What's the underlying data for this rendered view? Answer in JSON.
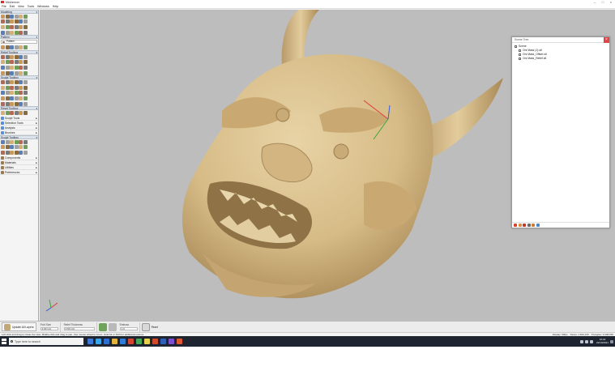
{
  "window": {
    "title": "Meshmixer",
    "controls": [
      "–",
      "□",
      "×"
    ]
  },
  "menu": [
    "File",
    "Edit",
    "View",
    "Tools",
    "Windows",
    "Help"
  ],
  "left_panel": {
    "sections": [
      {
        "title": "Modeling",
        "rows": 4
      },
      {
        "title": "Pattern",
        "rows": 1,
        "dropdown": "Pattern"
      },
      {
        "title": "Relief Toolbox",
        "rows": 4
      },
      {
        "title": "Sculpt Toolbox",
        "rows": 5
      },
      {
        "title": "Reset Toolbox",
        "rows": 1
      },
      {
        "title": "Sculpt Toolbox",
        "rows": 3
      }
    ],
    "nav_items": [
      "Sculpt Tools",
      "Selection Tools",
      "Analysis",
      "Brushes"
    ],
    "nav_items2": [
      "Components",
      "Materials",
      "Utilities",
      "Preferences"
    ]
  },
  "dialog": {
    "title": "Scene Tree",
    "tree": [
      {
        "label": "Scene",
        "child": false
      },
      {
        "label": "Oni Mask (1).stl",
        "child": true
      },
      {
        "label": "Oni Mask_Offset.stl",
        "child": true
      },
      {
        "label": "Oni Mask_Relief.stl",
        "child": true
      }
    ],
    "footer_icons": [
      "new-icon",
      "copy-icon",
      "delete-icon",
      "merge-icon",
      "visible-icon",
      "zoom-icon"
    ]
  },
  "bottom_bar": {
    "main_button": "Update All Layers",
    "groups": [
      {
        "label": "Fold Size",
        "value": "2.00 mm"
      },
      {
        "label": "Relief Thickness",
        "value": "0.50 mm"
      },
      {
        "label": "Emboss",
        "value": "1.0"
      }
    ],
    "toggle_label": "Reset"
  },
  "status": {
    "left": "Left-click and drag to rotate the view. Middle-click and drag to pan. Use mouse wheel to zoom. Hold Alt or Shift for additional options.",
    "right": [
      "Display: 60fps",
      "Faces: 1,824,315",
      "Triangles: 3,648,630"
    ]
  },
  "taskbar": {
    "search_placeholder": "Type here to search",
    "time": "10:42",
    "date": "22/10/2021",
    "app_colors": [
      "#3b78d8",
      "#3aa4e8",
      "#2b6fd1",
      "#e2b23a",
      "#2f7bd8",
      "#d6432f",
      "#44a855",
      "#e6d24a",
      "#d04a2a",
      "#2d5fb8",
      "#7c4fd0",
      "#e0572f"
    ]
  },
  "colors": {
    "viewport_bg": "#bdbdbd",
    "model": "#d9c08e",
    "model_shade": "#b8996a",
    "model_dark": "#8f7245",
    "tool_palette": [
      "#c79a5c",
      "#8a6a3f",
      "#5b7fb3",
      "#a0a0a0",
      "#d1b07a",
      "#6e9e58",
      "#b36a55",
      "#7a7a7a"
    ]
  }
}
